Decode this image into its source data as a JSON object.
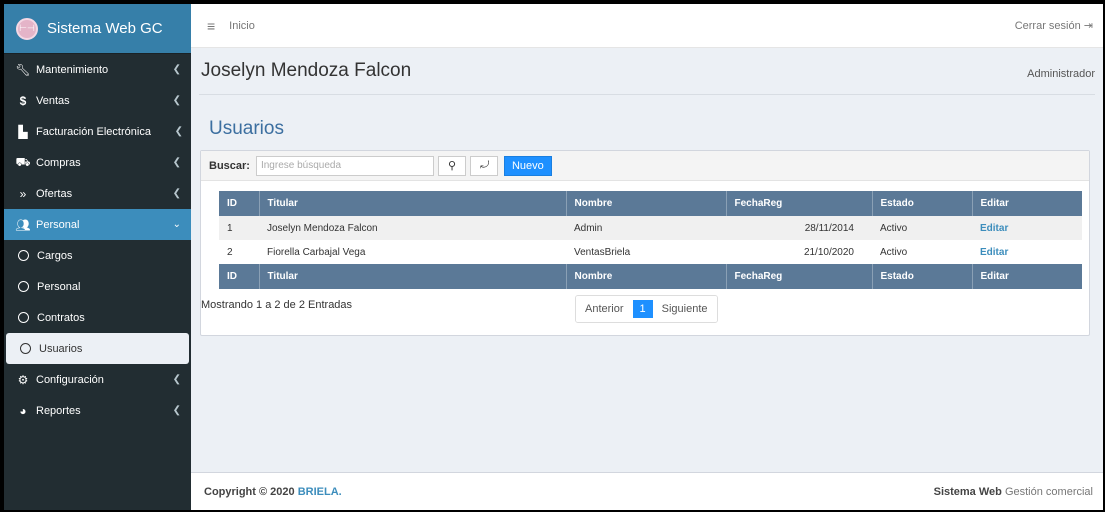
{
  "app": {
    "title": "Sistema Web GC",
    "logo_text": "⊢⊣"
  },
  "sidebar": {
    "items": [
      {
        "label": "Mantenimiento",
        "icon": "wrench-icon"
      },
      {
        "label": "Ventas",
        "icon": "dollar-icon"
      },
      {
        "label": "Facturación Electrónica",
        "icon": "building-icon"
      },
      {
        "label": "Compras",
        "icon": "cart-icon"
      },
      {
        "label": "Ofertas",
        "icon": "chevrons-icon"
      },
      {
        "label": "Personal",
        "icon": "users-icon"
      },
      {
        "label": "Configuración",
        "icon": "gear-icon"
      },
      {
        "label": "Reportes",
        "icon": "pie-chart-icon"
      }
    ],
    "subitems": [
      {
        "label": "Cargos"
      },
      {
        "label": "Personal"
      },
      {
        "label": "Contratos"
      },
      {
        "label": "Usuarios"
      }
    ]
  },
  "topbar": {
    "home": "Inicio",
    "logout": "Cerrar sesión"
  },
  "header": {
    "user_name": "Joselyn Mendoza Falcon",
    "role": "Administrador"
  },
  "page": {
    "title": "Usuarios"
  },
  "search": {
    "label": "Buscar:",
    "placeholder": "Ingrese búsqueda",
    "new_label": "Nuevo"
  },
  "table": {
    "columns": [
      "ID",
      "Titular",
      "Nombre",
      "FechaReg",
      "Estado",
      "Editar"
    ],
    "rows": [
      {
        "id": "1",
        "titular": "Joselyn Mendoza Falcon",
        "nombre": "Admin",
        "fecha": "28/11/2014",
        "estado": "Activo",
        "editar": "Editar"
      },
      {
        "id": "2",
        "titular": "Fiorella Carbajal Vega",
        "nombre": "VentasBriela",
        "fecha": "21/10/2020",
        "estado": "Activo",
        "editar": "Editar"
      }
    ]
  },
  "pagination": {
    "showing": "Mostrando 1 a 2 de 2 Entradas",
    "prev": "Anterior",
    "current": "1",
    "next": "Siguiente"
  },
  "footer": {
    "copyright": "Copyright © 2020",
    "brand": "BRIELA.",
    "system_bold": "Sistema Web",
    "system_rest": "Gestión comercial"
  },
  "colors": {
    "sidebar_bg": "#222d32",
    "accent": "#3c8dbc",
    "table_header": "#5b7997",
    "primary_button": "#1e90ff"
  }
}
